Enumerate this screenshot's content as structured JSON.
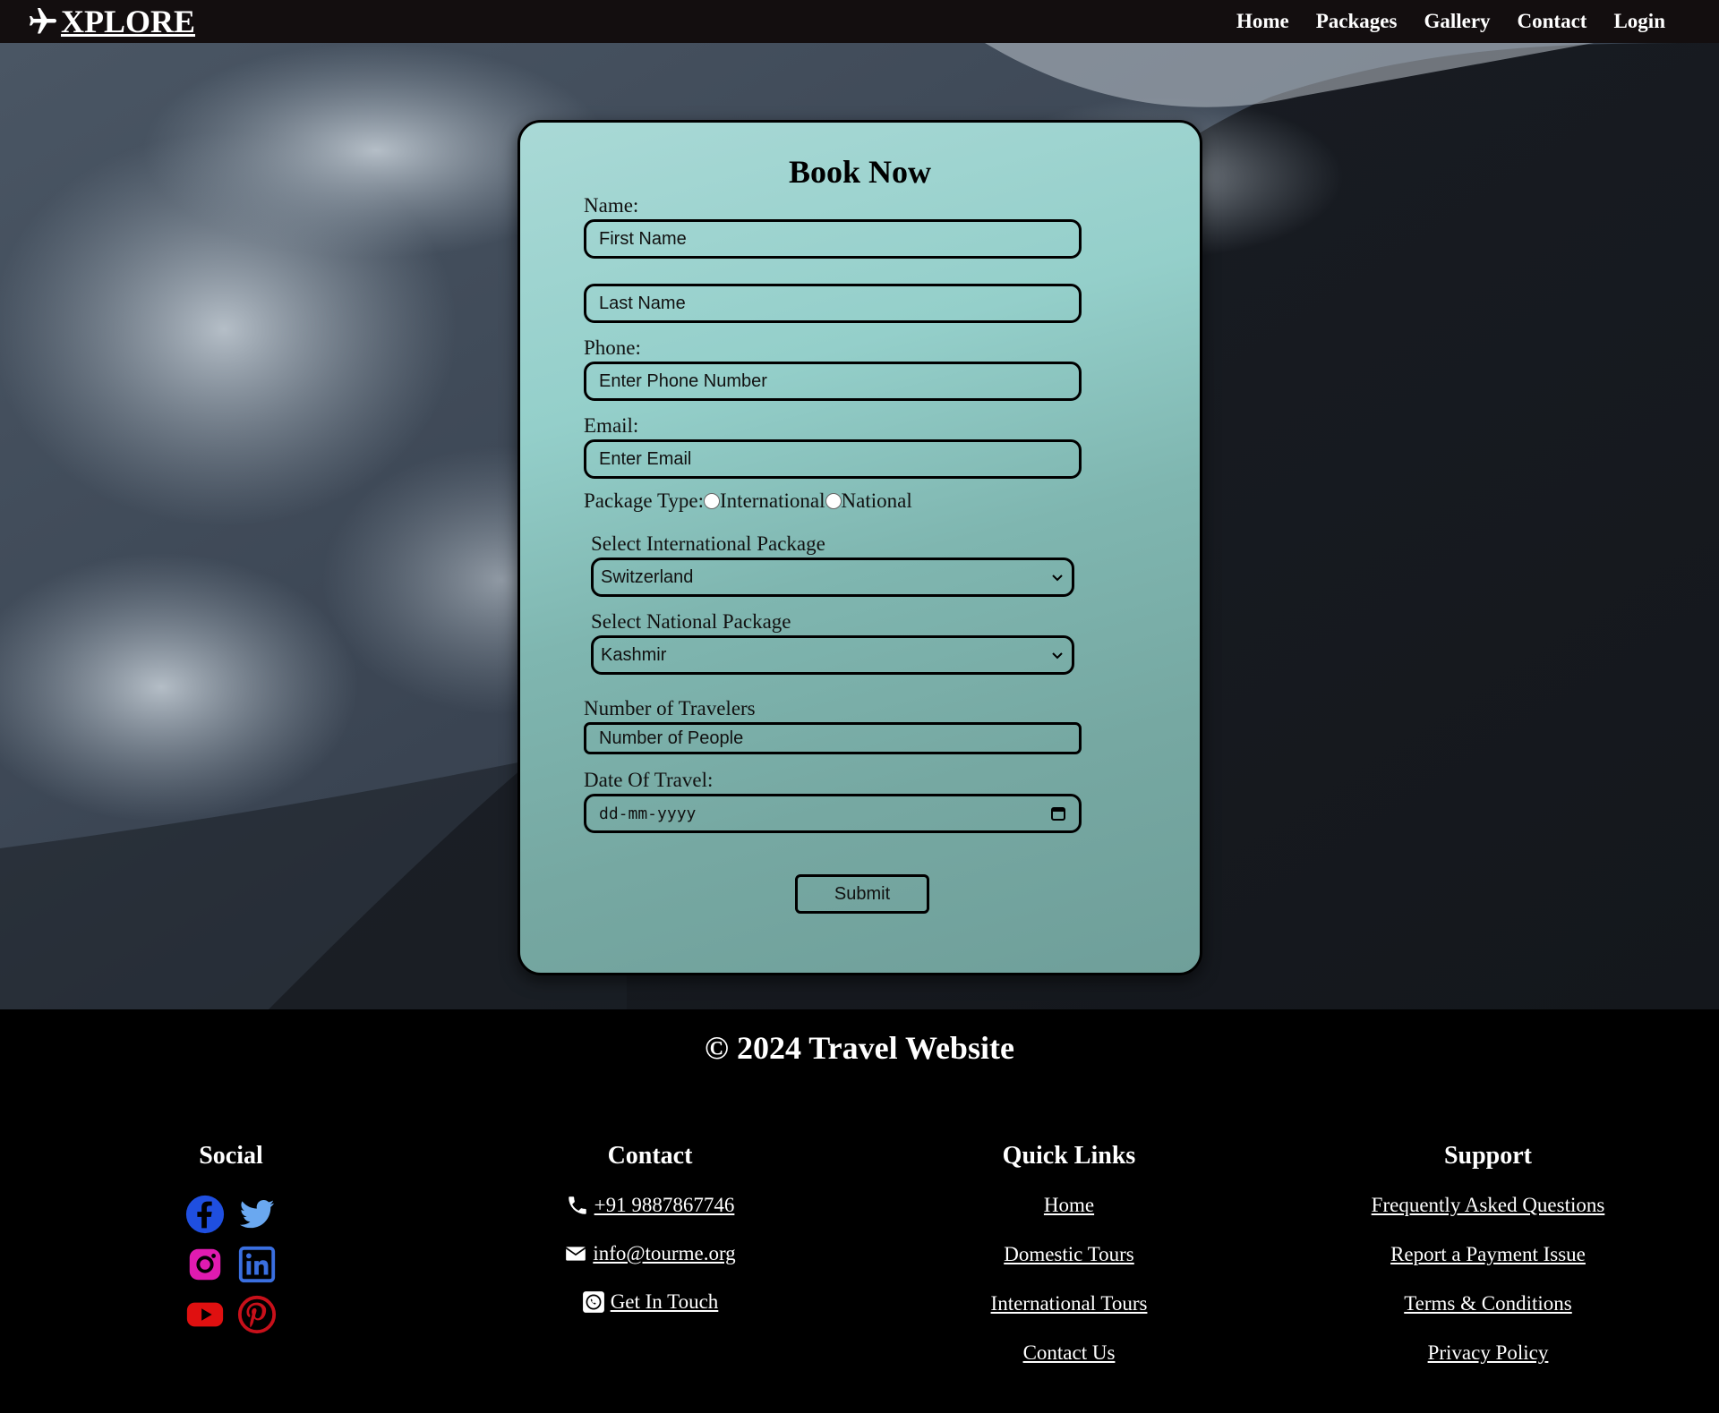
{
  "brand": {
    "name": "XPLORE",
    "icon": "airplane-icon"
  },
  "nav": {
    "items": [
      "Home",
      "Packages",
      "Gallery",
      "Contact",
      "Login"
    ]
  },
  "form": {
    "title": "Book Now",
    "name_label": "Name:",
    "first_name_placeholder": "First Name",
    "last_name_placeholder": "Last Name",
    "phone_label": "Phone:",
    "phone_placeholder": "Enter Phone Number",
    "email_label": "Email:",
    "email_placeholder": "Enter Email",
    "package_type_label": "Package Type:",
    "package_type_options": [
      "International",
      "National"
    ],
    "intl_label": "Select International Package",
    "intl_selected": "Switzerland",
    "national_label": "Select National Package",
    "national_selected": "Kashmir",
    "travelers_label": "Number of Travelers",
    "travelers_placeholder": "Number of People",
    "date_label": "Date Of Travel:",
    "date_placeholder": "dd-mm-yyyy",
    "submit_label": "Submit"
  },
  "footer": {
    "copyright": "© 2024 Travel Website",
    "social": {
      "title": "Social",
      "icons": [
        "facebook-icon",
        "twitter-icon",
        "instagram-icon",
        "linkedin-icon",
        "youtube-icon",
        "pinterest-icon"
      ]
    },
    "contact": {
      "title": "Contact",
      "phone": "+91 9887867746",
      "email": "info@tourme.org",
      "whatsapp": "Get In Touch"
    },
    "quick_links": {
      "title": "Quick Links",
      "items": [
        "Home",
        "Domestic Tours",
        "International Tours",
        "Contact Us"
      ]
    },
    "support": {
      "title": "Support",
      "items": [
        "Frequently Asked Questions",
        "Report a Payment Issue",
        "Terms & Conditions",
        "Privacy Policy"
      ]
    }
  },
  "colors": {
    "navbar": "#130e0f",
    "card_top": "#a9d9d6",
    "card_bottom": "#6f9f9a",
    "footer": "#000000",
    "facebook": "#1f4fe0",
    "twitter": "#6aa8f0",
    "instagram": "#e01bb0",
    "linkedin": "#3a6fe0",
    "youtube": "#e01010",
    "pinterest": "#c8101a"
  }
}
